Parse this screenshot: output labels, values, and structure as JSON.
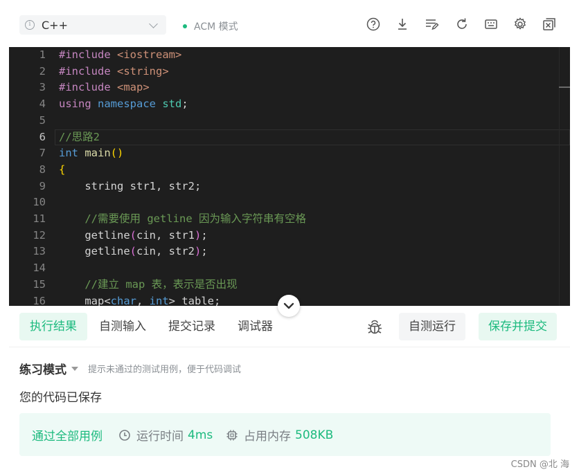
{
  "toolbar": {
    "language": "C++",
    "mode_label": "ACM 模式",
    "icons": [
      "help-icon",
      "download-icon",
      "format-icon",
      "reset-icon",
      "keyboard-icon",
      "settings-icon",
      "fullscreen-icon"
    ]
  },
  "editor": {
    "active_line": 6,
    "lines": [
      {
        "n": "1",
        "tokens": [
          {
            "c": "pre",
            "t": "#include "
          },
          {
            "c": "inc",
            "t": "<iostream>"
          }
        ]
      },
      {
        "n": "2",
        "tokens": [
          {
            "c": "pre",
            "t": "#include "
          },
          {
            "c": "inc",
            "t": "<string>"
          }
        ]
      },
      {
        "n": "3",
        "tokens": [
          {
            "c": "pre",
            "t": "#include "
          },
          {
            "c": "inc",
            "t": "<map>"
          }
        ]
      },
      {
        "n": "4",
        "tokens": [
          {
            "c": "pre",
            "t": "using "
          },
          {
            "c": "blue",
            "t": "namespace "
          },
          {
            "c": "type",
            "t": "std"
          },
          {
            "c": "",
            "t": ";"
          }
        ]
      },
      {
        "n": "5",
        "tokens": []
      },
      {
        "n": "6",
        "tokens": [
          {
            "c": "com",
            "t": "//思路2"
          }
        ]
      },
      {
        "n": "7",
        "tokens": [
          {
            "c": "blue",
            "t": "int "
          },
          {
            "c": "fn",
            "t": "main"
          },
          {
            "c": "br",
            "t": "()"
          }
        ]
      },
      {
        "n": "8",
        "tokens": [
          {
            "c": "br",
            "t": "{"
          }
        ]
      },
      {
        "n": "9",
        "tokens": [
          {
            "c": "",
            "t": "    string str1, str2;"
          }
        ]
      },
      {
        "n": "10",
        "tokens": []
      },
      {
        "n": "11",
        "tokens": [
          {
            "c": "com",
            "t": "    //需要使用 getline 因为输入字符串有空格"
          }
        ]
      },
      {
        "n": "12",
        "tokens": [
          {
            "c": "",
            "t": "    getline"
          },
          {
            "c": "pb",
            "t": "("
          },
          {
            "c": "",
            "t": "cin, str1"
          },
          {
            "c": "pb",
            "t": ")"
          },
          {
            "c": "",
            "t": ";"
          }
        ]
      },
      {
        "n": "13",
        "tokens": [
          {
            "c": "",
            "t": "    getline"
          },
          {
            "c": "pb",
            "t": "("
          },
          {
            "c": "",
            "t": "cin, str2"
          },
          {
            "c": "pb",
            "t": ")"
          },
          {
            "c": "",
            "t": ";"
          }
        ]
      },
      {
        "n": "14",
        "tokens": []
      },
      {
        "n": "15",
        "tokens": [
          {
            "c": "com",
            "t": "    //建立 map 表，表示是否出现"
          }
        ]
      },
      {
        "n": "16",
        "tokens": [
          {
            "c": "",
            "t": "    map<"
          },
          {
            "c": "blue",
            "t": "char"
          },
          {
            "c": "",
            "t": ", "
          },
          {
            "c": "blue",
            "t": "int"
          },
          {
            "c": "",
            "t": "> table;"
          }
        ]
      }
    ]
  },
  "tabs": {
    "result": "执行结果",
    "custom_input": "自测输入",
    "history": "提交记录",
    "debugger": "调试器"
  },
  "actions": {
    "self_test": "自测运行",
    "save_submit": "保存并提交"
  },
  "result": {
    "mode_title": "练习模式",
    "mode_hint": "提示未通过的测试用例，便于代码调试",
    "saved_message": "您的代码已保存",
    "pass_label": "通过全部用例",
    "runtime_label": "运行时间",
    "runtime_value": "4ms",
    "memory_label": "占用内存",
    "memory_value": "508KB"
  },
  "watermark": "CSDN @北   海",
  "colors": {
    "accent_green": "#1cba7e",
    "editor_bg": "#1e1e1e"
  }
}
